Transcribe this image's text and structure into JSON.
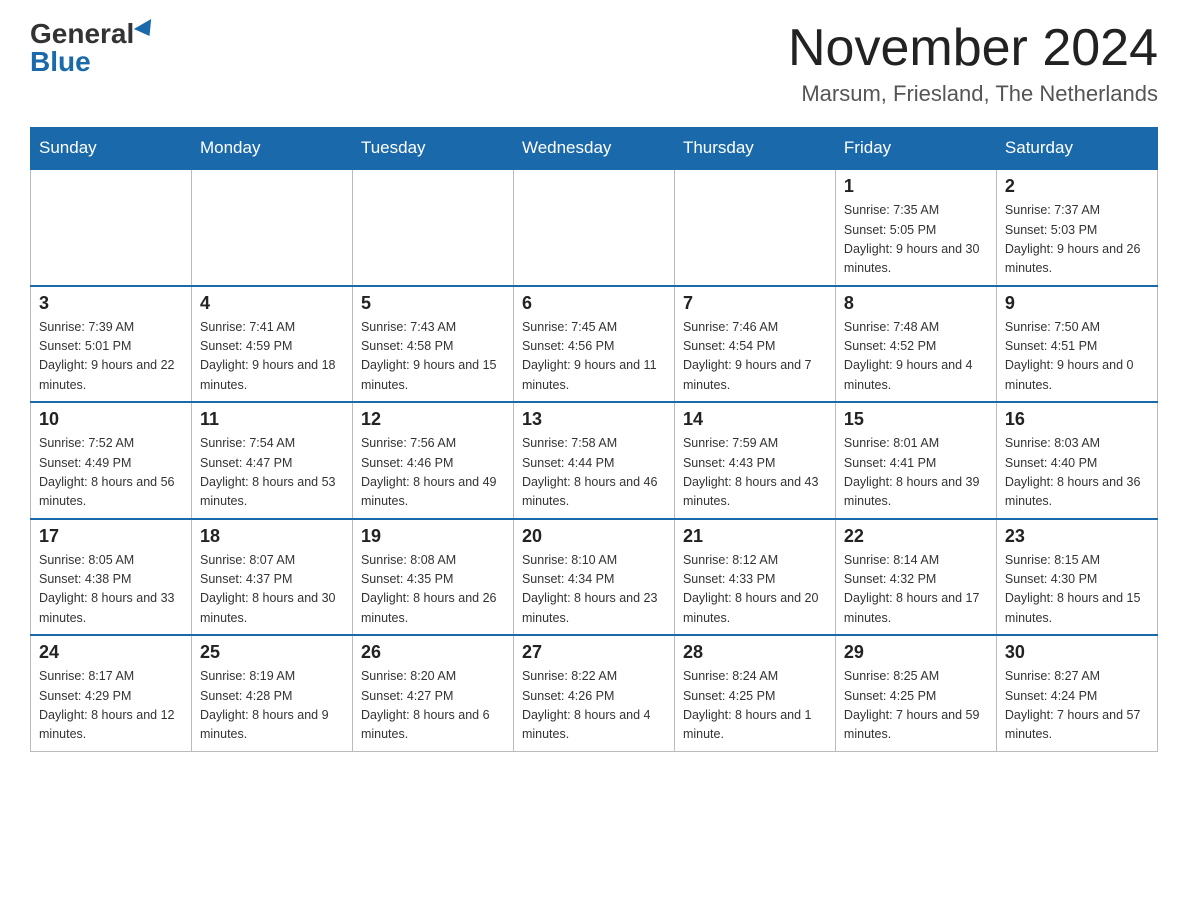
{
  "header": {
    "logo_general": "General",
    "logo_blue": "Blue",
    "month_title": "November 2024",
    "location": "Marsum, Friesland, The Netherlands"
  },
  "days_of_week": [
    "Sunday",
    "Monday",
    "Tuesday",
    "Wednesday",
    "Thursday",
    "Friday",
    "Saturday"
  ],
  "weeks": [
    {
      "days": [
        {
          "number": "",
          "info": ""
        },
        {
          "number": "",
          "info": ""
        },
        {
          "number": "",
          "info": ""
        },
        {
          "number": "",
          "info": ""
        },
        {
          "number": "",
          "info": ""
        },
        {
          "number": "1",
          "info": "Sunrise: 7:35 AM\nSunset: 5:05 PM\nDaylight: 9 hours and 30 minutes."
        },
        {
          "number": "2",
          "info": "Sunrise: 7:37 AM\nSunset: 5:03 PM\nDaylight: 9 hours and 26 minutes."
        }
      ]
    },
    {
      "days": [
        {
          "number": "3",
          "info": "Sunrise: 7:39 AM\nSunset: 5:01 PM\nDaylight: 9 hours and 22 minutes."
        },
        {
          "number": "4",
          "info": "Sunrise: 7:41 AM\nSunset: 4:59 PM\nDaylight: 9 hours and 18 minutes."
        },
        {
          "number": "5",
          "info": "Sunrise: 7:43 AM\nSunset: 4:58 PM\nDaylight: 9 hours and 15 minutes."
        },
        {
          "number": "6",
          "info": "Sunrise: 7:45 AM\nSunset: 4:56 PM\nDaylight: 9 hours and 11 minutes."
        },
        {
          "number": "7",
          "info": "Sunrise: 7:46 AM\nSunset: 4:54 PM\nDaylight: 9 hours and 7 minutes."
        },
        {
          "number": "8",
          "info": "Sunrise: 7:48 AM\nSunset: 4:52 PM\nDaylight: 9 hours and 4 minutes."
        },
        {
          "number": "9",
          "info": "Sunrise: 7:50 AM\nSunset: 4:51 PM\nDaylight: 9 hours and 0 minutes."
        }
      ]
    },
    {
      "days": [
        {
          "number": "10",
          "info": "Sunrise: 7:52 AM\nSunset: 4:49 PM\nDaylight: 8 hours and 56 minutes."
        },
        {
          "number": "11",
          "info": "Sunrise: 7:54 AM\nSunset: 4:47 PM\nDaylight: 8 hours and 53 minutes."
        },
        {
          "number": "12",
          "info": "Sunrise: 7:56 AM\nSunset: 4:46 PM\nDaylight: 8 hours and 49 minutes."
        },
        {
          "number": "13",
          "info": "Sunrise: 7:58 AM\nSunset: 4:44 PM\nDaylight: 8 hours and 46 minutes."
        },
        {
          "number": "14",
          "info": "Sunrise: 7:59 AM\nSunset: 4:43 PM\nDaylight: 8 hours and 43 minutes."
        },
        {
          "number": "15",
          "info": "Sunrise: 8:01 AM\nSunset: 4:41 PM\nDaylight: 8 hours and 39 minutes."
        },
        {
          "number": "16",
          "info": "Sunrise: 8:03 AM\nSunset: 4:40 PM\nDaylight: 8 hours and 36 minutes."
        }
      ]
    },
    {
      "days": [
        {
          "number": "17",
          "info": "Sunrise: 8:05 AM\nSunset: 4:38 PM\nDaylight: 8 hours and 33 minutes."
        },
        {
          "number": "18",
          "info": "Sunrise: 8:07 AM\nSunset: 4:37 PM\nDaylight: 8 hours and 30 minutes."
        },
        {
          "number": "19",
          "info": "Sunrise: 8:08 AM\nSunset: 4:35 PM\nDaylight: 8 hours and 26 minutes."
        },
        {
          "number": "20",
          "info": "Sunrise: 8:10 AM\nSunset: 4:34 PM\nDaylight: 8 hours and 23 minutes."
        },
        {
          "number": "21",
          "info": "Sunrise: 8:12 AM\nSunset: 4:33 PM\nDaylight: 8 hours and 20 minutes."
        },
        {
          "number": "22",
          "info": "Sunrise: 8:14 AM\nSunset: 4:32 PM\nDaylight: 8 hours and 17 minutes."
        },
        {
          "number": "23",
          "info": "Sunrise: 8:15 AM\nSunset: 4:30 PM\nDaylight: 8 hours and 15 minutes."
        }
      ]
    },
    {
      "days": [
        {
          "number": "24",
          "info": "Sunrise: 8:17 AM\nSunset: 4:29 PM\nDaylight: 8 hours and 12 minutes."
        },
        {
          "number": "25",
          "info": "Sunrise: 8:19 AM\nSunset: 4:28 PM\nDaylight: 8 hours and 9 minutes."
        },
        {
          "number": "26",
          "info": "Sunrise: 8:20 AM\nSunset: 4:27 PM\nDaylight: 8 hours and 6 minutes."
        },
        {
          "number": "27",
          "info": "Sunrise: 8:22 AM\nSunset: 4:26 PM\nDaylight: 8 hours and 4 minutes."
        },
        {
          "number": "28",
          "info": "Sunrise: 8:24 AM\nSunset: 4:25 PM\nDaylight: 8 hours and 1 minute."
        },
        {
          "number": "29",
          "info": "Sunrise: 8:25 AM\nSunset: 4:25 PM\nDaylight: 7 hours and 59 minutes."
        },
        {
          "number": "30",
          "info": "Sunrise: 8:27 AM\nSunset: 4:24 PM\nDaylight: 7 hours and 57 minutes."
        }
      ]
    }
  ]
}
